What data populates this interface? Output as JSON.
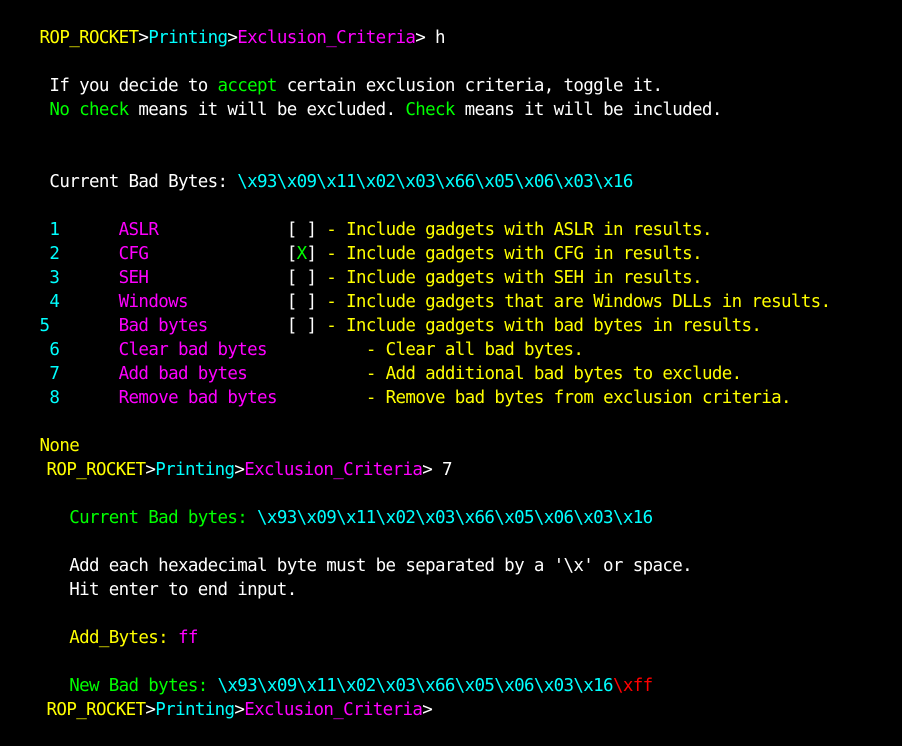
{
  "colors": {
    "background": "#000000",
    "white": "#ffffff",
    "yellow": "#ffff00",
    "cyan": "#00ffff",
    "magenta": "#ff00ff",
    "green": "#00ff00",
    "red": "#ff0000"
  },
  "prompt": {
    "program": "ROP_ROCKET",
    "sep": ">",
    "menu": "Printing",
    "submenu": "Exclusion_Criteria",
    "end": ">"
  },
  "session1": {
    "command": " h",
    "help1_a": " If you decide to ",
    "help1_b": "accept",
    "help1_c": " certain exclusion criteria, toggle it.",
    "help2_a": " No check",
    "help2_b": " means it will be excluded. ",
    "help2_c": "Check",
    "help2_d": " means it will be included.",
    "bad_label": " Current Bad Bytes: ",
    "bad_value": "\\x93\\x09\\x11\\x02\\x03\\x66\\x05\\x06\\x03\\x16"
  },
  "menu_items": [
    {
      "num": " 1",
      "gap": "      ",
      "name": "ASLR",
      "pad": "             ",
      "open": "[",
      "mark": " ",
      "close": "]",
      "desc": " - Include gadgets with ASLR in results."
    },
    {
      "num": " 2",
      "gap": "      ",
      "name": "CFG",
      "pad": "              ",
      "open": "[",
      "mark": "X",
      "close": "]",
      "desc": " - Include gadgets with CFG in results."
    },
    {
      "num": " 3",
      "gap": "      ",
      "name": "SEH",
      "pad": "              ",
      "open": "[",
      "mark": " ",
      "close": "]",
      "desc": " - Include gadgets with SEH in results."
    },
    {
      "num": " 4",
      "gap": "      ",
      "name": "Windows",
      "pad": "          ",
      "open": "[",
      "mark": " ",
      "close": "]",
      "desc": " - Include gadgets that are Windows DLLs in results."
    },
    {
      "num": "5",
      "gap": "       ",
      "name": "Bad bytes",
      "pad": "        ",
      "open": "[",
      "mark": " ",
      "close": "]",
      "desc": " - Include gadgets with bad bytes in results."
    },
    {
      "num": " 6",
      "gap": "      ",
      "name": "Clear bad bytes",
      "pad": "      ",
      "open": "",
      "mark": "",
      "close": "",
      "desc": "    - Clear all bad bytes."
    },
    {
      "num": " 7",
      "gap": "      ",
      "name": "Add bad bytes",
      "pad": "        ",
      "open": "",
      "mark": "",
      "close": "",
      "desc": "    - Add additional bad bytes to exclude."
    },
    {
      "num": " 8",
      "gap": "      ",
      "name": "Remove bad bytes",
      "pad": "     ",
      "open": "",
      "mark": "",
      "close": "",
      "desc": "    - Remove bad bytes from exclusion criteria."
    }
  ],
  "return_value": "None",
  "session2": {
    "command": " 7",
    "current_label": "   Current Bad bytes: ",
    "current_value": "\\x93\\x09\\x11\\x02\\x03\\x66\\x05\\x06\\x03\\x16",
    "instr1": "   Add each hexadecimal byte must be separated by a '\\x' or space.",
    "instr2": "   Hit enter to end input.",
    "add_label": "   Add_Bytes: ",
    "add_value": "ff",
    "new_label": "   New Bad bytes: ",
    "new_value": "\\x93\\x09\\x11\\x02\\x03\\x66\\x05\\x06\\x03\\x16",
    "new_added": "\\xff"
  },
  "prompt_last_lead": ""
}
